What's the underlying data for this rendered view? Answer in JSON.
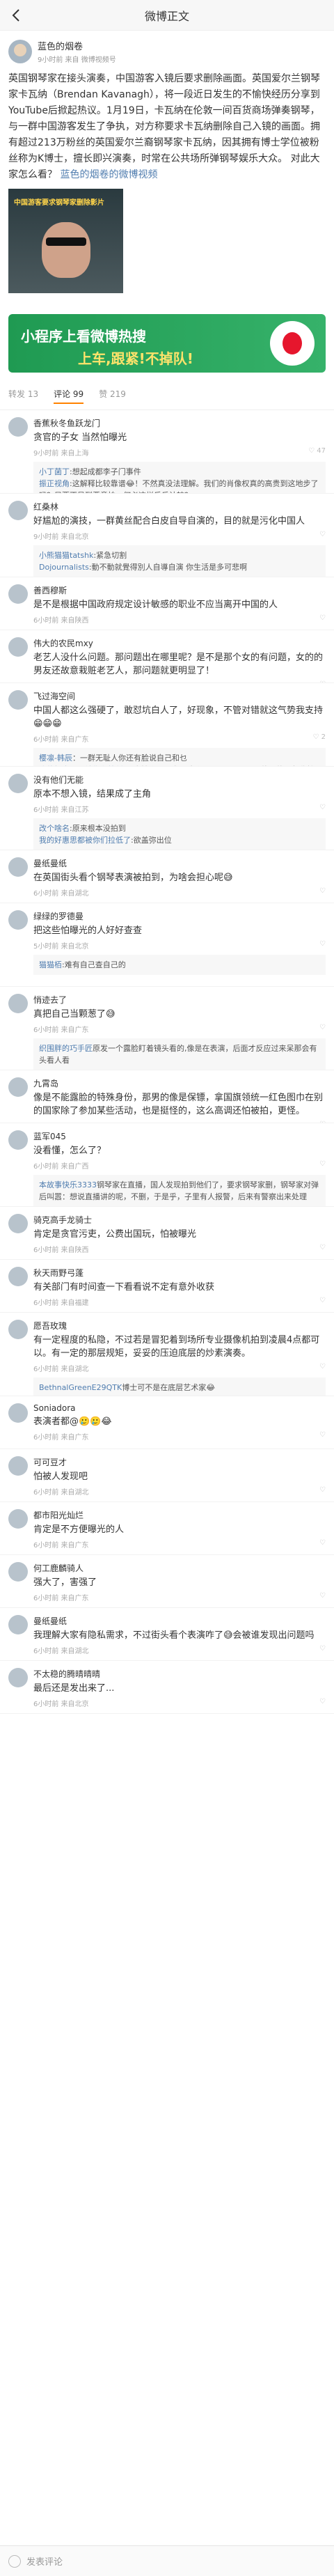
{
  "nav": {
    "title": "微博正文"
  },
  "post": {
    "author": "蓝色的烟卷",
    "meta": "9小时前 来自 微博视频号",
    "text": "英国钢琴家在接头演奏，中国游客入镜后要求删除画面。英国爱尔兰钢琴家卡瓦纳（Brendan Kavanagh），将一段近日发生的不愉快经历分享到YouTube后掀起热议。1月19日，卡瓦纳在伦敦一间百货商场弹奏钢琴，与一群中国游客发生了争执，对方称要求卡瓦纳删除自己入镜的画面。拥有超过213万粉丝的英国爱尔兰裔钢琴家卡瓦纳，因其拥有博士学位被粉丝称为K博士，擅长即兴演奏，时常在公共场所弹钢琴娱乐大众。 对此大家怎么看？",
    "link": "蓝色的烟卷的微博视频",
    "video_caption": "中国游客要求钢琴家删除影片"
  },
  "ad": {
    "line1": "小程序上看微博热搜",
    "line2": "上车,跟紧!不掉队!"
  },
  "tabs": {
    "repost": "转发 13",
    "comment": "评论 99",
    "like": "赞 219"
  },
  "comments": [
    {
      "name": "香蕉秋冬鱼跃龙门",
      "text": "贪官的子女 当然怕曝光",
      "meta": "9小时前 来自上海",
      "likes": "47",
      "replies": [
        {
          "u": "小丁菌丁",
          "t": ":想起成都李子门事件"
        },
        {
          "u": "振正视角",
          "t": ":这解释比较靠谱😂！不然真没法理解。我们的肖像权真的高贵到这地步了吗？只要不是到恶意拍，何必这样斤斤计较？"
        }
      ],
      "more": "共9条回复 >"
    },
    {
      "name": "红桑林",
      "text": "好尴尬的演技，一群黄丝配合白皮自导自演的，目的就是污化中国人",
      "meta": "9小时前 来自北京",
      "likes": "",
      "replies": [
        {
          "u": "小熊猫猫tatshk",
          "t": ":紧急切割"
        },
        {
          "u": "Dojournalists",
          "t": ":動不動就覺得別人自導自演 你生活是多可悲啊"
        }
      ],
      "more": "共2条回复 >"
    },
    {
      "name": "善西穆斯",
      "text": "是不是根据中国政府规定设计敏感的职业不应当离开中国的人",
      "meta": "6小时前 来自陕西",
      "likes": "",
      "replies": [],
      "more": ""
    },
    {
      "name": "伟大的农民mxy",
      "text": "老艺人没什么问题。那问题出在哪里呢？是不是那个女的有问题，女的的男友还故意栽赃老艺人，那问题就更明显了！",
      "meta": "6小时前 来自安徽",
      "likes": "",
      "replies": [],
      "more": ""
    },
    {
      "name": "飞过海空间",
      "text": "中国人都这么强硬了，敢怼坑白人了，好现象，不管对错就这气势我支持😁😁😁",
      "meta": "6小时前 来自广东",
      "likes": "2",
      "replies": [
        {
          "u": "樱凛-韩辰",
          "t": "：一群无耻人你还有脸说自己和乜"
        },
        {
          "u": "我的好惠思都被你们拉低了",
          "t": ":支持个屁，尤其这个don't touch her的男的，欠收拾"
        }
      ],
      "more": "共3条回复 >"
    },
    {
      "name": "没有他们无能",
      "text": "原本不想入镜，结果成了主角",
      "meta": "6小时前 来自江苏",
      "likes": "",
      "replies": [
        {
          "u": "改个啥名",
          "t": ":原来根本没拍到"
        },
        {
          "u": "我的好惠思都被你们拉低了",
          "t": ":欲盖弥出位"
        }
      ],
      "more": "共2条回复 >"
    },
    {
      "name": "曼纸曼纸",
      "text": "在英国街头看个钢琴表演被拍到，为啥会担心呢😅",
      "meta": "6小时前 来自湖北",
      "likes": "",
      "replies": [],
      "more": ""
    },
    {
      "name": "绿绿的罗德曼",
      "text": "把这些怕曝光的人好好查查",
      "meta": "5小时前 来自北京",
      "likes": "",
      "replies": [
        {
          "u": "猫猫栢",
          "t": ":难有自己查自己的"
        }
      ],
      "more": ""
    },
    {
      "name": "悄迹去了",
      "text": "真把自己当颗葱了😅",
      "meta": "6小时前 来自广东",
      "likes": "",
      "replies": [
        {
          "u": "织围胖的巧手匠",
          "t": "原发一个露脸盯着镜头看的,像是在表演，后面才反应过来呆那会有头看人看"
        }
      ],
      "more": ""
    },
    {
      "name": "九霄岛",
      "text": "像是不能露脸的特殊身份，那男的像是保镖，拿国旗领统一红色图巾在别的国家除了参加某些活动，也是挺怪的，这么高调还怕被拍，更怪。",
      "meta": "6小时前 来自福建",
      "likes": "",
      "replies": [],
      "more": ""
    },
    {
      "name": "蓝军045",
      "text": "没看懂，怎么了？",
      "meta": "6小时前 来自广西",
      "likes": "",
      "replies": [
        {
          "u": "本故事快乐3333",
          "t": "钢琴家在直播，国人发现拍到他们了，要求钢琴家删，钢琴家对弹后叫嚣：想说直播讲的呢，不删，于是乎，子里有人报警，后来有警察出来处理"
        }
      ],
      "more": ""
    },
    {
      "name": "骑克高手龙骑士",
      "text": "肯定是贪官污吏，公费出国玩，怕被曝光",
      "meta": "6小时前 来自陕西",
      "likes": "",
      "replies": [],
      "more": ""
    },
    {
      "name": "秋天雨野弓蓬",
      "text": "有关部门有时间查一下看看说不定有意外收获",
      "meta": "6小时前 来自福建",
      "likes": "",
      "replies": [],
      "more": ""
    },
    {
      "name": "愿吾玫瑰",
      "text": "有一定程度的私隐，不过若是冒犯着到场所专业摄像机拍到凌晨4点都可以。有一定的那层规矩，妥妥的压迫底层的炒素演奏。",
      "meta": "6小时前 来自湖北",
      "likes": "",
      "replies": [
        {
          "u": "BethnalGreenE29QTK",
          "t": "博士可不是在底层艺术家😂"
        }
      ],
      "more": ""
    },
    {
      "name": "Soniadora",
      "text": "表演者都@🥲🥲😂",
      "meta": "6小时前 来自广东",
      "likes": "",
      "replies": [],
      "more": ""
    },
    {
      "name": "可可豆才",
      "text": "怕被人发现吧",
      "meta": "6小时前 来自湖北",
      "likes": "",
      "replies": [],
      "more": ""
    },
    {
      "name": "都市阳光灿烂",
      "text": "肯定是不方便曝光的人",
      "meta": "6小时前 来自广东",
      "likes": "",
      "replies": [],
      "more": ""
    },
    {
      "name": "何工鹿麟骑人",
      "text": "强大了，害强了",
      "meta": "6小时前 来自广东",
      "likes": "",
      "replies": [],
      "more": ""
    },
    {
      "name": "曼纸曼纸",
      "text": "我理解大家有隐私需求，不过街头看个表演咋了😅会被谁发现出问题吗",
      "meta": "6小时前 来自湖北",
      "likes": "",
      "replies": [],
      "more": ""
    },
    {
      "name": "不太稳的腾晴晴晴",
      "text": "最后还是发出来了...",
      "meta": "6小时前 来自北京",
      "likes": "",
      "replies": [],
      "more": ""
    }
  ],
  "footer": {
    "placeholder": "发表评论"
  }
}
